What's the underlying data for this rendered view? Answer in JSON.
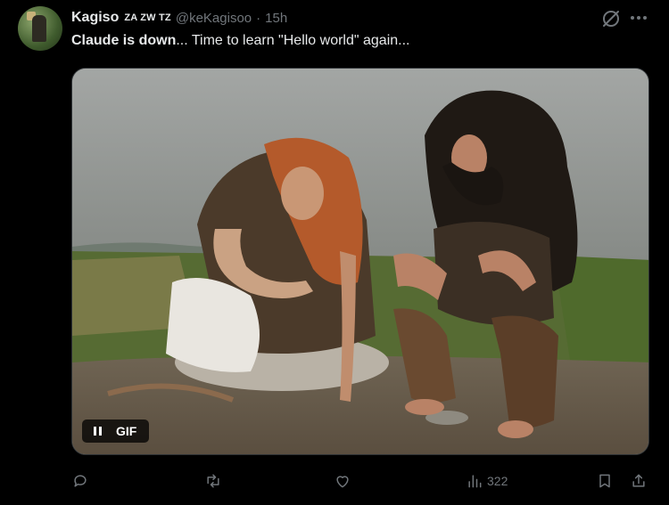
{
  "tweet": {
    "author_name": "Kagiso",
    "author_flags": "ZA ZW TZ",
    "handle": "@keKagisoo",
    "separator": "·",
    "time": "15h",
    "text_bold": "Claude is down",
    "text_rest": "... Time to learn \"Hello world\" again...",
    "media": {
      "type": "gif",
      "badge_label": "GIF",
      "playback_state": "playing"
    },
    "actions": {
      "reply_icon": "reply-icon",
      "retweet_icon": "retweet-icon",
      "like_icon": "heart-icon",
      "views_icon": "views-chart-icon",
      "views_count": "322",
      "bookmark_icon": "bookmark-icon",
      "share_icon": "share-icon"
    }
  },
  "colors": {
    "background": "#000000",
    "text_primary": "#e7e9ea",
    "text_secondary": "#71767b"
  }
}
